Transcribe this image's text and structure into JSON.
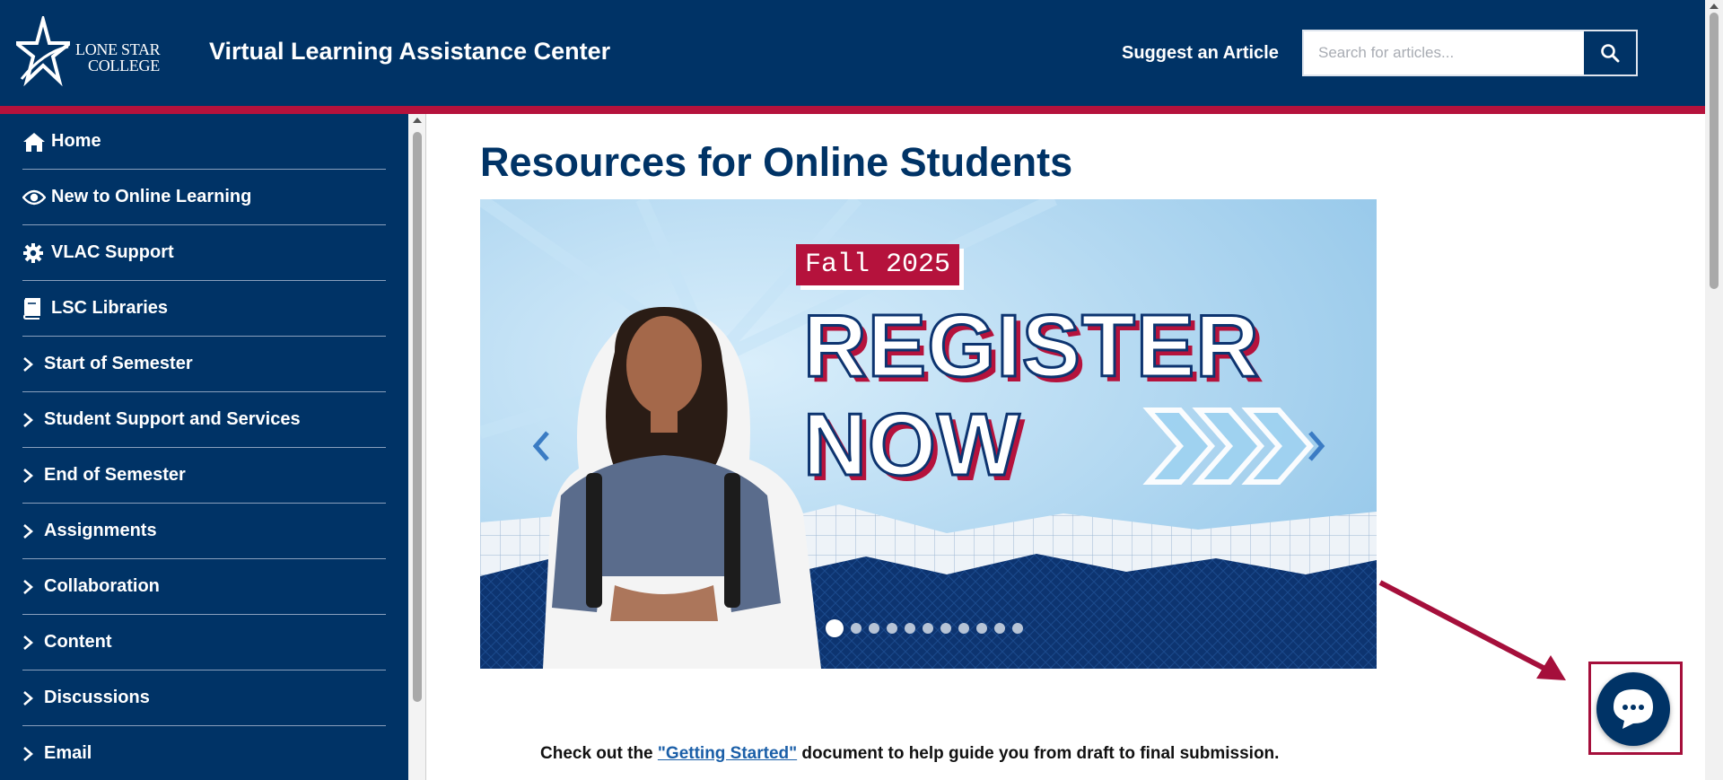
{
  "header": {
    "logo_line1": "LONE STAR",
    "logo_line2": "COLLEGE",
    "title": "Virtual Learning Assistance Center",
    "suggest_link": "Suggest an Article",
    "search_placeholder": "Search for articles..."
  },
  "sidebar": {
    "items": [
      {
        "label": "Home",
        "icon": "home-icon"
      },
      {
        "label": "New to Online Learning",
        "icon": "eye-icon"
      },
      {
        "label": "VLAC Support",
        "icon": "gear-icon"
      },
      {
        "label": "LSC Libraries",
        "icon": "book-icon"
      },
      {
        "label": "Start of Semester",
        "icon": "chevron-right-icon"
      },
      {
        "label": "Student Support and Services",
        "icon": "chevron-right-icon"
      },
      {
        "label": "End of Semester",
        "icon": "chevron-right-icon"
      },
      {
        "label": "Assignments",
        "icon": "chevron-right-icon"
      },
      {
        "label": "Collaboration",
        "icon": "chevron-right-icon"
      },
      {
        "label": "Content",
        "icon": "chevron-right-icon"
      },
      {
        "label": "Discussions",
        "icon": "chevron-right-icon"
      },
      {
        "label": "Email",
        "icon": "chevron-right-icon"
      }
    ]
  },
  "main": {
    "title": "Resources for Online Students",
    "banner": {
      "tag": "Fall 2025",
      "headline_1": "REGISTER",
      "headline_2": "NOW",
      "slide_count": 11,
      "active_slide": 1
    },
    "intro_before": "Check out the ",
    "intro_link": "\"Getting Started\"",
    "intro_after": " document to help guide you from draft to final submission."
  },
  "colors": {
    "brand_navy": "#003366",
    "brand_red": "#b5123c",
    "banner_sky": "#a9d4ef"
  }
}
